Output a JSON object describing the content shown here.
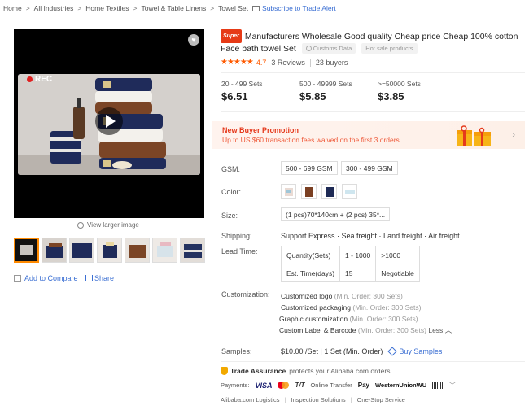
{
  "breadcrumb": {
    "items": [
      "Home",
      "All Industries",
      "Home Textiles",
      "Towel & Table Linens",
      "Towel Set"
    ],
    "subscribe": "Subscribe to Trade Alert"
  },
  "gallery": {
    "rec_label": "REC",
    "view_larger": "View larger image",
    "add_to_compare": "Add to Compare",
    "share": "Share",
    "thumb_count": 7
  },
  "product": {
    "badge": "Super",
    "title": "Manufacturers Wholesale Good quality Cheap price Cheap 100% cotton Face bath towel Set",
    "chips": [
      "Customs Data",
      "Hot sale products"
    ],
    "rating": "4.7",
    "reviews": "3 Reviews",
    "buyers": "23 buyers"
  },
  "price_tiers": [
    {
      "qty": "20 - 499 Sets",
      "price": "$6.51"
    },
    {
      "qty": "500 - 49999 Sets",
      "price": "$5.85"
    },
    {
      "qty": ">=50000 Sets",
      "price": "$3.85"
    }
  ],
  "promo": {
    "title": "New Buyer Promotion",
    "text": "Up to US $60 transaction fees waived on the first 3 orders"
  },
  "gsm": {
    "label": "GSM:",
    "options": [
      "500 - 699 GSM",
      "300 - 499 GSM"
    ]
  },
  "color": {
    "label": "Color:",
    "swatches": [
      "#e9dad3",
      "#7a3f22",
      "#1e2a55",
      "#cfe6ef"
    ]
  },
  "size": {
    "label": "Size:",
    "value": "(1 pcs)70*140cm + (2 pcs) 35*..."
  },
  "shipping": {
    "label": "Shipping:",
    "value": "Support Express · Sea freight · Land freight · Air freight"
  },
  "lead_time": {
    "label": "Lead Time:",
    "rows": [
      [
        "Quantity(Sets)",
        "1 - 1000",
        ">1000"
      ],
      [
        "Est. Time(days)",
        "15",
        "Negotiable"
      ]
    ]
  },
  "customization": {
    "label": "Customization:",
    "items": [
      {
        "name": "Customized logo",
        "moq": "(Min. Order: 300 Sets)"
      },
      {
        "name": "Customized packaging",
        "moq": "(Min. Order: 300 Sets)"
      },
      {
        "name": "Graphic customization",
        "moq": "(Min. Order: 300 Sets)"
      },
      {
        "name": "Custom Label & Barcode",
        "moq": "(Min. Order: 300 Sets)"
      }
    ],
    "less": "Less"
  },
  "samples": {
    "label": "Samples:",
    "value": "$10.00 /Set | 1 Set (Min. Order)",
    "buy": "Buy Samples"
  },
  "trade_assurance": {
    "title": "Trade Assurance",
    "subtitle": "protects your Alibaba.com orders"
  },
  "payments": {
    "label": "Payments:",
    "methods": [
      "VISA",
      "T/T",
      "Online Transfer",
      "Pay",
      "WesternUnionWU"
    ]
  },
  "services": [
    "Alibaba.com Logistics",
    "Inspection Solutions",
    "One-Stop Service"
  ]
}
